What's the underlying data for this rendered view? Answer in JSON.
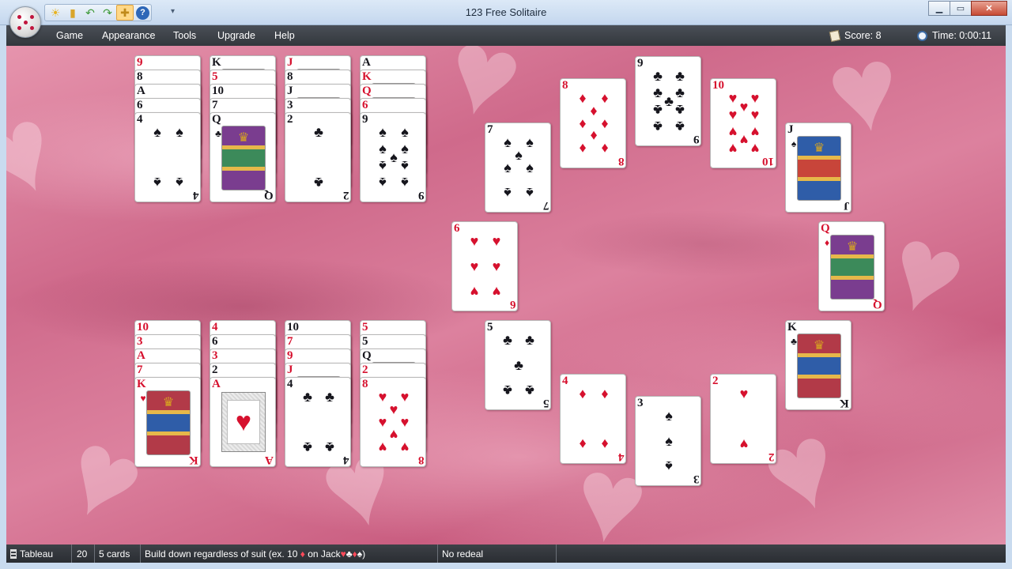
{
  "window": {
    "title": "123 Free Solitaire",
    "controls": {
      "minimize": "▁",
      "maximize": "▭",
      "close": "✕"
    }
  },
  "quick_toolbar": {
    "buttons": [
      {
        "icon": "sun-icon",
        "glyph": "☀"
      },
      {
        "icon": "cards-icon",
        "glyph": "▮"
      },
      {
        "icon": "undo-arrow-icon",
        "glyph": "↶"
      },
      {
        "icon": "redo-arrow-icon",
        "glyph": "↷"
      },
      {
        "icon": "hint-icon",
        "glyph": "✚"
      },
      {
        "icon": "help-icon",
        "glyph": "?"
      }
    ],
    "more": "▾"
  },
  "menu": {
    "items": [
      "Game",
      "Appearance",
      "Tools",
      "Upgrade",
      "Help"
    ],
    "score_text": "Score:  8",
    "time_text": "Time:  0:00:11"
  },
  "colors": {
    "felt": "#d77796",
    "card_red": "#d6112e",
    "card_black": "#16161d",
    "menubar": "#3b3f45"
  },
  "piles": [
    {
      "name": "pile-1",
      "cards": [
        {
          "rank": "9",
          "suit": "♥"
        },
        {
          "rank": "8",
          "suit": "♠"
        },
        {
          "rank": "A",
          "suit": "♠"
        },
        {
          "rank": "6",
          "suit": "♠"
        },
        {
          "rank": "4",
          "suit": "♠"
        }
      ]
    },
    {
      "name": "pile-2",
      "cards": [
        {
          "rank": "K",
          "suit": "♠"
        },
        {
          "rank": "5",
          "suit": "♦"
        },
        {
          "rank": "10",
          "suit": "♠"
        },
        {
          "rank": "7",
          "suit": "♠"
        },
        {
          "rank": "Q",
          "suit": "♣"
        }
      ]
    },
    {
      "name": "pile-3",
      "cards": [
        {
          "rank": "J",
          "suit": "♦"
        },
        {
          "rank": "8",
          "suit": "♣"
        },
        {
          "rank": "J",
          "suit": "♣"
        },
        {
          "rank": "3",
          "suit": "♠"
        },
        {
          "rank": "2",
          "suit": "♣"
        }
      ]
    },
    {
      "name": "pile-4",
      "cards": [
        {
          "rank": "A",
          "suit": "♣"
        },
        {
          "rank": "K",
          "suit": "♦"
        },
        {
          "rank": "Q",
          "suit": "♦"
        },
        {
          "rank": "6",
          "suit": "♦"
        },
        {
          "rank": "9",
          "suit": "♠"
        }
      ]
    },
    {
      "name": "pile-5",
      "cards": [
        {
          "rank": "10",
          "suit": "♦"
        },
        {
          "rank": "3",
          "suit": "♥"
        },
        {
          "rank": "A",
          "suit": "♦"
        },
        {
          "rank": "7",
          "suit": "♥"
        },
        {
          "rank": "K",
          "suit": "♥"
        }
      ]
    },
    {
      "name": "pile-6",
      "cards": [
        {
          "rank": "4",
          "suit": "♦"
        },
        {
          "rank": "6",
          "suit": "♠"
        },
        {
          "rank": "3",
          "suit": "♦"
        },
        {
          "rank": "2",
          "suit": "♠"
        },
        {
          "rank": "A",
          "suit": "♥"
        }
      ]
    },
    {
      "name": "pile-7",
      "cards": [
        {
          "rank": "10",
          "suit": "♣"
        },
        {
          "rank": "7",
          "suit": "♦"
        },
        {
          "rank": "9",
          "suit": "♦"
        },
        {
          "rank": "J",
          "suit": "♥"
        },
        {
          "rank": "4",
          "suit": "♣"
        }
      ]
    },
    {
      "name": "pile-8",
      "cards": [
        {
          "rank": "5",
          "suit": "♥"
        },
        {
          "rank": "5",
          "suit": "♣"
        },
        {
          "rank": "Q",
          "suit": "♣"
        },
        {
          "rank": "2",
          "suit": "♥"
        },
        {
          "rank": "8",
          "suit": "♥"
        }
      ]
    }
  ],
  "circle_cards": [
    {
      "rank": "7",
      "suit": "♠"
    },
    {
      "rank": "8",
      "suit": "♦"
    },
    {
      "rank": "9",
      "suit": "♣"
    },
    {
      "rank": "10",
      "suit": "♥"
    },
    {
      "rank": "J",
      "suit": "♠"
    },
    {
      "rank": "6",
      "suit": "♥"
    },
    {
      "rank": "Q",
      "suit": "♦"
    },
    {
      "rank": "5",
      "suit": "♣"
    },
    {
      "rank": "K",
      "suit": "♣"
    },
    {
      "rank": "4",
      "suit": "♦"
    },
    {
      "rank": "3",
      "suit": "♠"
    },
    {
      "rank": "2",
      "suit": "♥"
    }
  ],
  "status": {
    "mode": "Tableau",
    "number": "20",
    "cards": "5 cards",
    "rule_prefix": "Build down regardless of suit (ex. 10",
    "rule_red": "♦",
    "rule_mid": "on Jack",
    "rule_suits_1": "♥",
    "rule_suits_2": "♣",
    "rule_suits_3": "♦",
    "rule_suits_4": "♠",
    "rule_suffix": ")",
    "redeal": "No redeal"
  }
}
